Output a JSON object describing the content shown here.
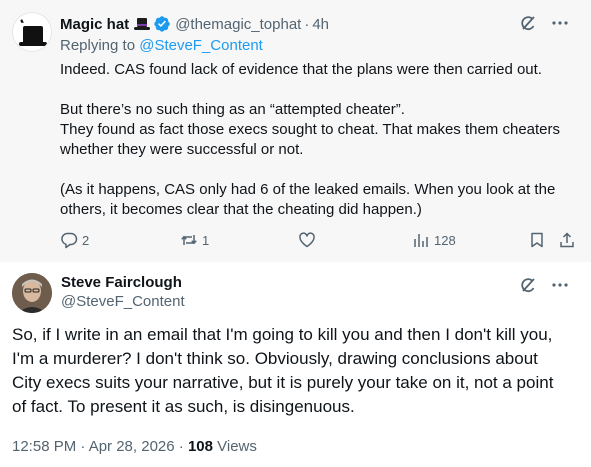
{
  "reply": {
    "author_name": "Magic hat",
    "handle": "@themagic_tophat",
    "time": "4h",
    "replying_prefix": "Replying to",
    "replying_to": "@SteveF_Content",
    "lines": [
      "Indeed. CAS found lack of evidence that the plans were then carried out.",
      "",
      "But there’s no such thing as an “attempted cheater”.",
      "They found as fact those execs sought to cheat. That makes them cheaters",
      "whether they were successful or not.",
      "",
      "(As it happens, CAS only had 6 of the leaked emails. When you look at the",
      "others, it becomes clear that the cheating did happen.)"
    ],
    "stats": {
      "replies": "2",
      "reposts": "1",
      "likes": "",
      "views": "128"
    }
  },
  "tweet": {
    "author_name": "Steve Fairclough",
    "handle": "@SteveF_Content",
    "lines": [
      "So, if I write in an email that I'm going to kill you and then I don't kill you,",
      "I'm a murderer? I don't think so. Obviously, drawing conclusions about",
      "City execs suits your narrative, but it is purely your take on it, not a point",
      "of fact. To present it as such, is disingenuous."
    ],
    "timestamp": "12:58 PM · Apr 28, 2026 · ",
    "views_count": "108",
    "views_label": " Views"
  },
  "colors": {
    "accent": "#1d9bf0",
    "text": "#0f1419",
    "muted": "#536471",
    "reply_bg": "#f7f7f7"
  }
}
